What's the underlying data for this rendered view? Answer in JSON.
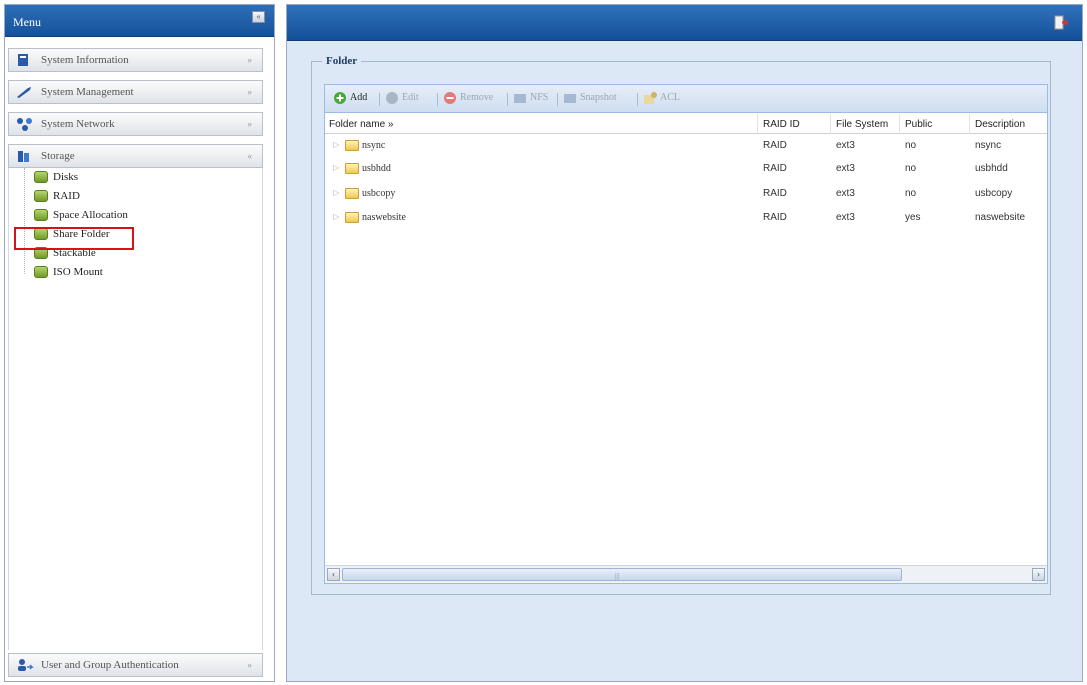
{
  "menu": {
    "title": "Menu",
    "collapse_glyph": "«",
    "sections": [
      {
        "label": "System Information",
        "icon": "system-info-icon",
        "toggle": "»"
      },
      {
        "label": "System Management",
        "icon": "system-management-icon",
        "toggle": "»"
      },
      {
        "label": "System Network",
        "icon": "system-network-icon",
        "toggle": "»"
      },
      {
        "label": "Storage",
        "icon": "storage-icon",
        "toggle": "«"
      }
    ],
    "storage_items": [
      "Disks",
      "RAID",
      "Space Allocation",
      "Share Folder",
      "Stackable",
      "ISO Mount"
    ],
    "bottom_section": {
      "label": "User and Group Authentication",
      "icon": "user-group-icon",
      "toggle": "»"
    }
  },
  "content": {
    "legend": "Folder",
    "toolbar": {
      "add": "Add",
      "edit": "Edit",
      "remove": "Remove",
      "nfs": "NFS",
      "snapshot": "Snapshot",
      "acl": "ACL"
    },
    "columns": [
      "Folder name »",
      "RAID ID",
      "File System",
      "Public",
      "Description"
    ],
    "rows": [
      {
        "name": "nsync",
        "raid": "RAID",
        "fs": "ext3",
        "public": "no",
        "desc": "nsync"
      },
      {
        "name": "usbhdd",
        "raid": "RAID",
        "fs": "ext3",
        "public": "no",
        "desc": "usbhdd"
      },
      {
        "name": "usbcopy",
        "raid": "RAID",
        "fs": "ext3",
        "public": "no",
        "desc": "usbcopy"
      },
      {
        "name": "naswebsite",
        "raid": "RAID",
        "fs": "ext3",
        "public": "yes",
        "desc": "naswebsite"
      }
    ],
    "scroll": {
      "left": "‹",
      "right": "›",
      "grip": "|||"
    }
  },
  "colors": {
    "header_blue": "#15529b",
    "panel_bg": "#dce8f6",
    "highlight_red": "#d3131c"
  }
}
